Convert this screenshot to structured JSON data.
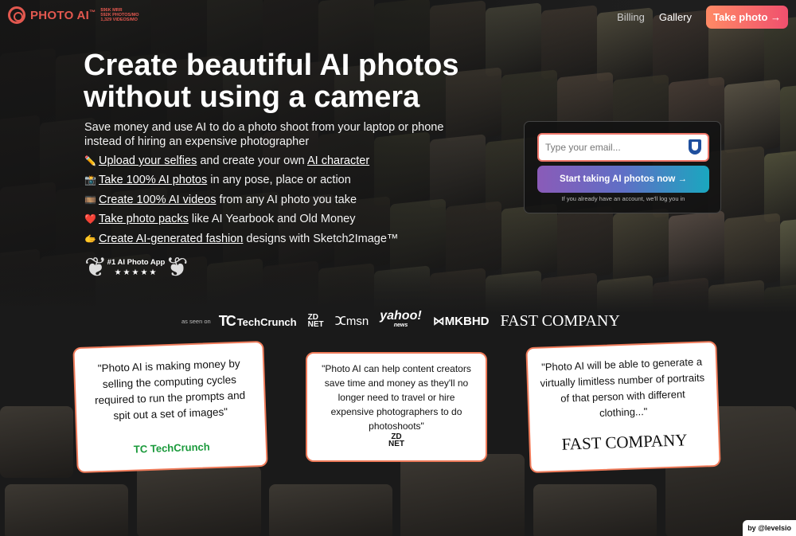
{
  "header": {
    "brand": "PHOTO AI",
    "brand_tm": "™",
    "stats": [
      "$96K MRR",
      "592K PHOTOS/MO",
      "1,329 VIDEOS/MO"
    ],
    "nav": {
      "billing": "Billing",
      "gallery": "Gallery",
      "take_photo": "Take photo →"
    }
  },
  "hero": {
    "title_line1": "Create beautiful AI photos",
    "title_line2": "without using a camera",
    "subtitle": "Save money and use AI to do a photo shoot from your laptop or phone instead of hiring an expensive photographer",
    "features": [
      {
        "emoji": "✏️",
        "link": "Upload your selfies",
        "mid": " and create your own ",
        "link2": "AI character",
        "rest": ""
      },
      {
        "emoji": "📸",
        "link": "Take 100% AI photos",
        "mid": " in any pose, place or action",
        "link2": "",
        "rest": ""
      },
      {
        "emoji": "🎞️",
        "link": "Create 100% AI videos",
        "mid": " from any AI photo you take",
        "link2": "",
        "rest": ""
      },
      {
        "emoji": "❤️",
        "link": "Take photo packs",
        "mid": " like AI Yearbook and Old Money",
        "link2": "",
        "rest": ""
      },
      {
        "emoji": "🫱",
        "link": "Create AI-generated fashion",
        "mid": " designs with Sketch2Image™",
        "link2": "",
        "rest": ""
      }
    ],
    "award": {
      "title": "#1 AI Photo App",
      "stars": "★★★★★"
    }
  },
  "signup": {
    "email_placeholder": "Type your email...",
    "cta": "Start taking AI photos now →",
    "note": "If you already have an account, we'll log you in"
  },
  "press": {
    "label": "as seen on",
    "techcrunch_mark": "TC",
    "techcrunch": "TechCrunch",
    "zdnet_top": "ZD",
    "zdnet_bottom": "NET",
    "msn": "msn",
    "yahoo": "yahoo!",
    "yahoo_sub": "news",
    "mkbhd": "MKBHD",
    "fastcompany": "FAST COMPANY"
  },
  "quotes": [
    {
      "text": "\"Photo AI is making money by selling the computing cycles required to run the prompts and spit out a set of images\"",
      "source_mark": "TC",
      "source": "TechCrunch"
    },
    {
      "text": "\"Photo AI can help content creators save time and money as they'll no longer need to travel or hire expensive photographers to do photoshoots\"",
      "source_top": "ZD",
      "source_bottom": "NET"
    },
    {
      "text": "\"Photo AI will be able to generate a virtually limitless number of portraits of that person with different clothing...\"",
      "source": "FAST COMPANY"
    }
  ],
  "byline": "by @levelsio",
  "colors": {
    "brand": "#e2584f",
    "accent_orange": "#ef7b5a",
    "cta_start": "#8a5bb8",
    "cta_end": "#1aa7bf"
  }
}
